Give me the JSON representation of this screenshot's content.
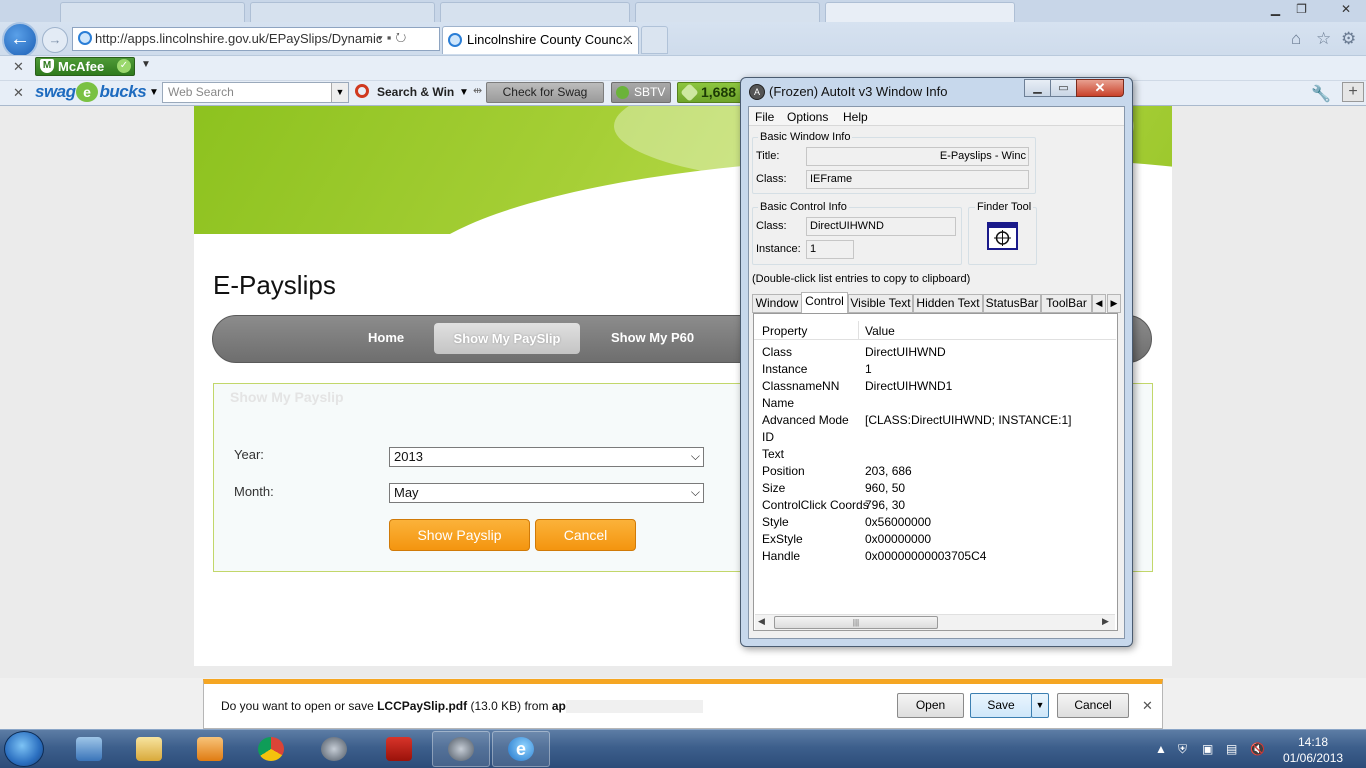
{
  "browser": {
    "address": "http://apps.lincolnshire.gov.uk/EPaySlips/Dynamic",
    "active_tab": "Lincolnshire County Counc...",
    "toolbar": {
      "mcafee": "McAfee",
      "swagbucks": "swag",
      "swagbucks_suffix": "bucks",
      "search_placeholder": "Web Search",
      "search_win": "Search & Win",
      "swag_code": "Check for Swag Code",
      "sbtv": "SBTV",
      "count": "1,688"
    }
  },
  "page": {
    "title": "E-Payslips",
    "nav": [
      "Home",
      "Show My PaySlip",
      "Show My P60"
    ],
    "form_heading": "Show My Payslip",
    "year_label": "Year:",
    "year_value": "2013",
    "month_label": "Month:",
    "month_value": "May",
    "show_button": "Show Payslip",
    "cancel_button": "Cancel"
  },
  "autoit": {
    "title": "(Frozen) AutoIt v3 Window Info",
    "menu": [
      "File",
      "Options",
      "Help"
    ],
    "basic_window": {
      "group": "Basic Window Info",
      "title_label": "Title:",
      "title_value": "E-Payslips - Winc",
      "class_label": "Class:",
      "class_value": "IEFrame"
    },
    "basic_control": {
      "group": "Basic Control Info",
      "class_label": "Class:",
      "class_value": "DirectUIHWND",
      "instance_label": "Instance:",
      "instance_value": "1"
    },
    "finder": "Finder Tool",
    "hint": "(Double-click list entries to copy to clipboard)",
    "tabs": [
      "Window",
      "Control",
      "Visible Text",
      "Hidden Text",
      "StatusBar",
      "ToolBar"
    ],
    "columns": [
      "Property",
      "Value"
    ],
    "rows": [
      [
        "Class",
        "DirectUIHWND"
      ],
      [
        "Instance",
        "1"
      ],
      [
        "ClassnameNN",
        "DirectUIHWND1"
      ],
      [
        "Name",
        ""
      ],
      [
        "Advanced Mode",
        "[CLASS:DirectUIHWND; INSTANCE:1]"
      ],
      [
        "ID",
        ""
      ],
      [
        "Text",
        ""
      ],
      [
        "Position",
        "203, 686"
      ],
      [
        "Size",
        "960, 50"
      ],
      [
        "ControlClick Coords",
        "796, 30"
      ],
      [
        "Style",
        "0x56000000"
      ],
      [
        "ExStyle",
        "0x00000000"
      ],
      [
        "Handle",
        "0x00000000003705C4"
      ]
    ]
  },
  "download": {
    "prefix": "Do you want to open or save ",
    "file": "LCCPaySlip.pdf",
    "size": " (13.0 KB) from ",
    "source": "apps.",
    "open": "Open",
    "save": "Save",
    "cancel": "Cancel"
  },
  "taskbar": {
    "time": "14:18",
    "date": "01/06/2013"
  },
  "colors": {
    "banner_green": "#8dc21f",
    "nav_gray": "#7a7a7a",
    "orange_button": "#f4950f",
    "download_accent": "#f5a623"
  }
}
